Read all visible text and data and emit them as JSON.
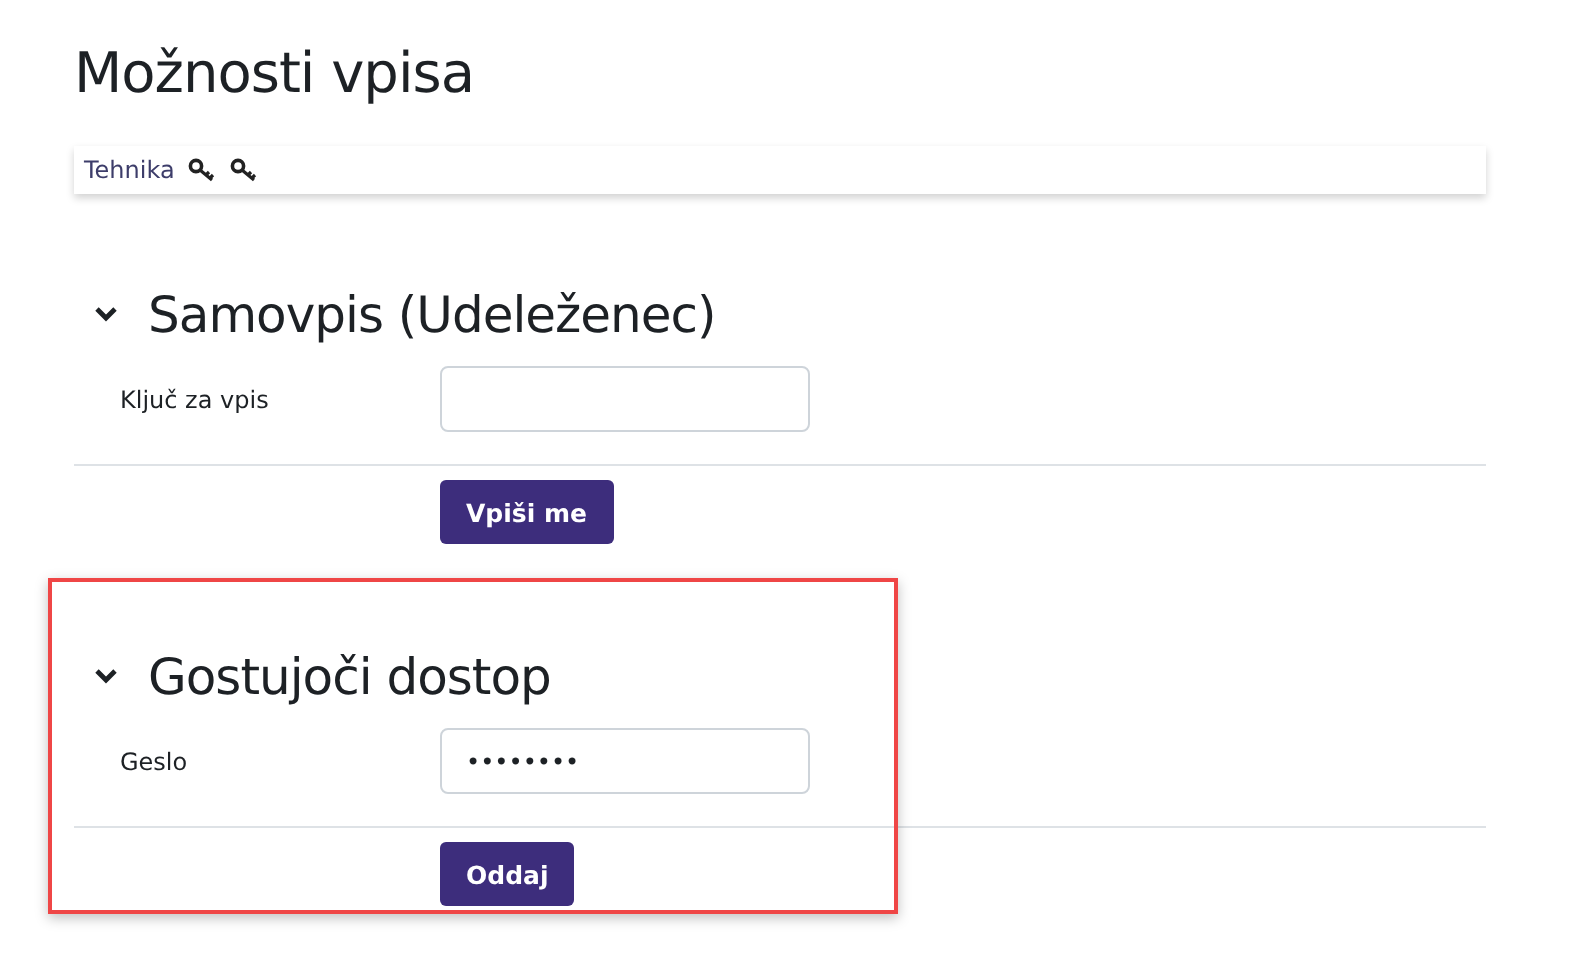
{
  "title": "Možnosti vpisa",
  "course_info": {
    "label": "Tehnika",
    "icons": [
      {
        "kind": "key"
      },
      {
        "kind": "key"
      }
    ]
  },
  "sections": [
    {
      "heading": "Samovpis (Udeleženec)",
      "expanded": true,
      "highlighted": false,
      "field_label": "Ključ za vpis",
      "button": "Vpiši me"
    },
    {
      "heading": "Gostujoči dostop",
      "expanded": true,
      "highlighted": true,
      "field_label": "Geslo",
      "field_value": "••••••••",
      "button": "Oddaj"
    }
  ]
}
